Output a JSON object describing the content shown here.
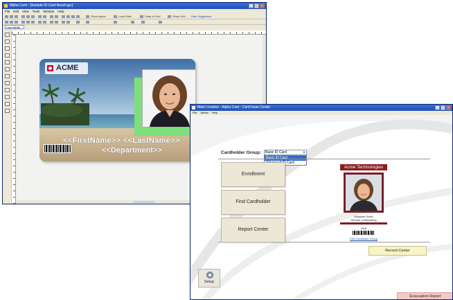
{
  "designer_window": {
    "title": "Alpha Card - [Sample ID Card Beach.jpc]",
    "menu": [
      "File",
      "Edit",
      "View",
      "Tools",
      "Window",
      "Help"
    ],
    "toolbar_options": [
      "Show layers",
      "Lock Ratio",
      "Snap to Grid",
      "Show Grid"
    ],
    "toolbar_link": "Help Suggestion",
    "zoom_value": "Card Width",
    "card": {
      "logo_text": "ACME",
      "name_placeholder": "<<FirstName>> <<LastName>>",
      "department_placeholder": "<<Department>>"
    }
  },
  "issue_center_window": {
    "title": "Main Location - Alpha Card - Card Issue Center",
    "menu": [
      "File",
      "Admin",
      "Help"
    ],
    "cardholder_group_label": "Cardholder Group:",
    "group_selected": "Basic ID Card",
    "group_options": [
      "Basic ID Card",
      "Advanced ID Card"
    ],
    "buttons": {
      "enrollment": "Enrollment",
      "find_cardholder": "Find Cardholder",
      "report_center": "Report Center",
      "recent_cards": "Record Center",
      "setup": "Setup",
      "evacuation_report": "Evacuation Report"
    },
    "preview": {
      "company": "Acme Technologies",
      "name": "Margaret Smith",
      "title": "Director of Marketing",
      "id_number": "0438",
      "edit_link": "Edit Cardholder Group"
    }
  }
}
